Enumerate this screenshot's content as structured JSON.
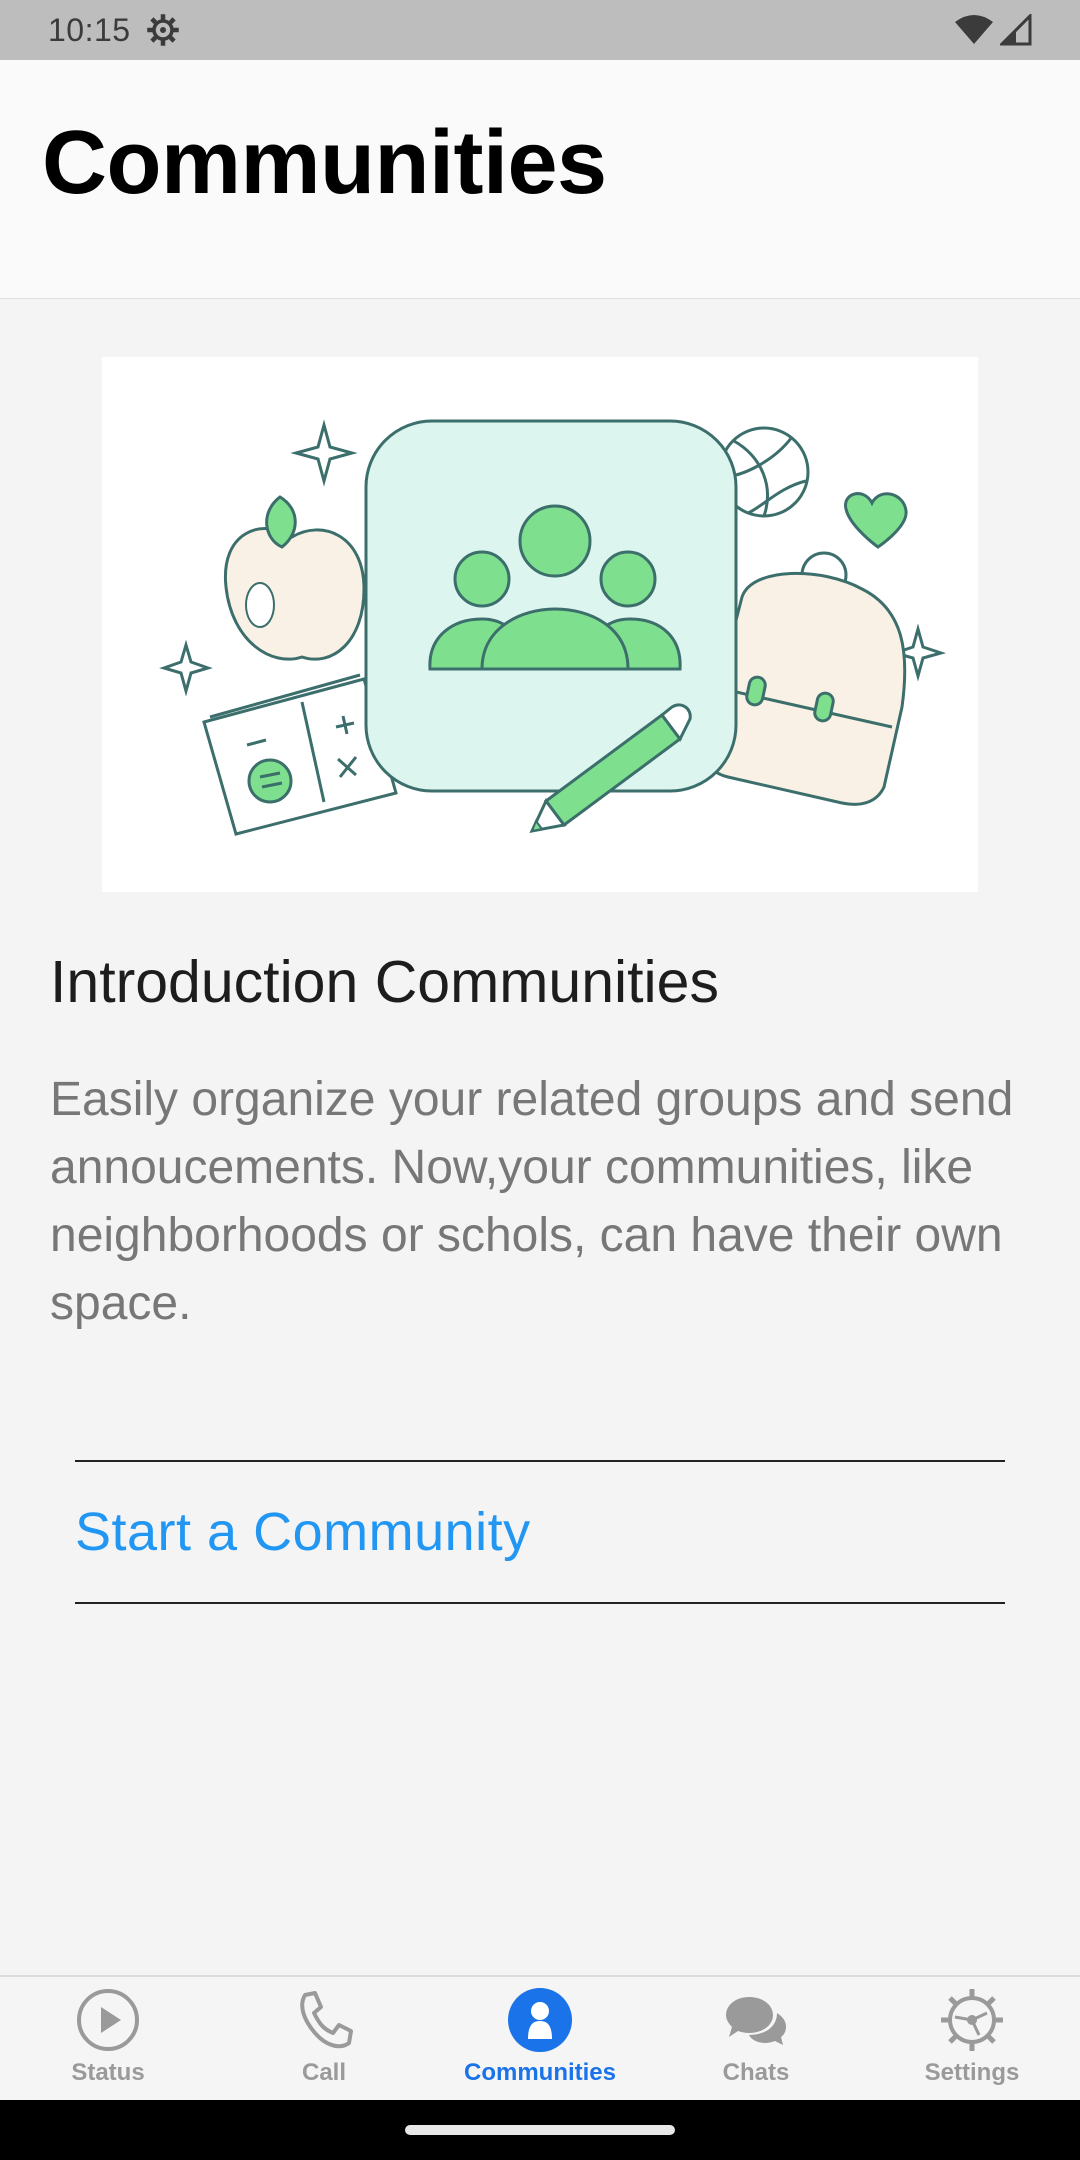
{
  "status_bar": {
    "time": "10:15"
  },
  "header": {
    "title": "Communities"
  },
  "intro": {
    "title": "Introduction Communities",
    "description": "Easily organize your related groups and send annoucements. Now,your communities, like neighborhoods or schols, can have their own space."
  },
  "cta": {
    "label": "Start a Community"
  },
  "tabs": [
    {
      "label": "Status",
      "icon": "play-circle-icon",
      "active": false
    },
    {
      "label": "Call",
      "icon": "phone-icon",
      "active": false
    },
    {
      "label": "Communities",
      "icon": "communities-icon",
      "active": true
    },
    {
      "label": "Chats",
      "icon": "chat-bubbles-icon",
      "active": false
    },
    {
      "label": "Settings",
      "icon": "gear-icon",
      "active": false
    }
  ],
  "colors": {
    "accent": "#2196f3",
    "tab_active": "#1a73e8",
    "illustration_green": "#7ee08f"
  }
}
